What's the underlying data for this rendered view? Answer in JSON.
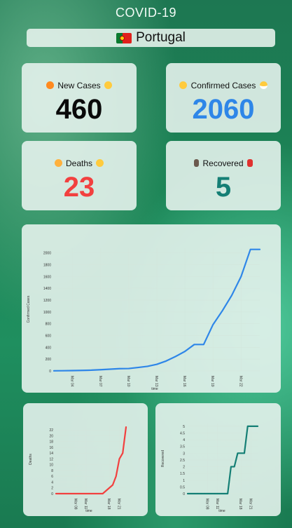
{
  "app": {
    "title": "COVID-19"
  },
  "country": {
    "name": "Portugal",
    "flag_icon": "portugal-flag-icon"
  },
  "stats": [
    {
      "key": "new_cases",
      "label": "New Cases",
      "value": "460",
      "color": "#0a0a0a",
      "icons": [
        "fire-icon",
        "screaming-face-icon"
      ]
    },
    {
      "key": "confirmed",
      "label": "Confirmed Cases",
      "value": "2060",
      "color": "#2e86e8",
      "icons": [
        "sick-face-icon",
        "mask-face-icon"
      ]
    },
    {
      "key": "deaths",
      "label": "Deaths",
      "value": "23",
      "color": "#f2403f",
      "icons": [
        "sad-face-icon",
        "disappointed-face-icon"
      ]
    },
    {
      "key": "recovered",
      "label": "Recovered",
      "value": "5",
      "color": "#157f75",
      "icons": [
        "walking-person-icon",
        "dancing-woman-icon"
      ]
    }
  ],
  "chart_data": [
    {
      "type": "line",
      "xlabel": "time",
      "ylabel": "Confirmed Cases",
      "x": [
        "Mar 02",
        "Mar 03",
        "Mar 04",
        "Mar 05",
        "Mar 06",
        "Mar 07",
        "Mar 08",
        "Mar 09",
        "Mar 10",
        "Mar 11",
        "Mar 12",
        "Mar 13",
        "Mar 14",
        "Mar 15",
        "Mar 16",
        "Mar 17",
        "Mar 18",
        "Mar 19",
        "Mar 20",
        "Mar 21",
        "Mar 22",
        "Mar 23",
        "Mar 24"
      ],
      "xticks": [
        "Mar 04",
        "Mar 07",
        "Mar 10",
        "Mar 13",
        "Mar 16",
        "Mar 19",
        "Mar 22"
      ],
      "yticks": [
        0,
        200,
        400,
        600,
        800,
        1000,
        1200,
        1400,
        1600,
        1800,
        2000
      ],
      "ylim": [
        0,
        2080
      ],
      "color": "#2e86e8",
      "values": [
        2,
        4,
        6,
        9,
        13,
        21,
        30,
        39,
        41,
        59,
        78,
        112,
        169,
        245,
        331,
        448,
        448,
        785,
        1020,
        1280,
        1600,
        2060,
        2060
      ]
    },
    {
      "type": "line",
      "xlabel": "time",
      "ylabel": "Deaths",
      "x": [
        "Mar 02",
        "Mar 03",
        "Mar 04",
        "Mar 05",
        "Mar 06",
        "Mar 07",
        "Mar 08",
        "Mar 09",
        "Mar 10",
        "Mar 11",
        "Mar 12",
        "Mar 13",
        "Mar 14",
        "Mar 15",
        "Mar 16",
        "Mar 17",
        "Mar 18",
        "Mar 19",
        "Mar 20",
        "Mar 21",
        "Mar 22",
        "Mar 23"
      ],
      "xticks": [
        "Mar 08",
        "Mar 11",
        "Mar 18",
        "Mar 21"
      ],
      "yticks": [
        0,
        2,
        4,
        6,
        8,
        10,
        12,
        14,
        16,
        18,
        20,
        22
      ],
      "ylim": [
        0,
        23.5
      ],
      "color": "#f2403f",
      "values": [
        0,
        0,
        0,
        0,
        0,
        0,
        0,
        0,
        0,
        0,
        0,
        0,
        0,
        0,
        0,
        1,
        2,
        3,
        6,
        12,
        14,
        23
      ]
    },
    {
      "type": "line",
      "xlabel": "time",
      "ylabel": "Recovered",
      "x": [
        "Mar 02",
        "Mar 03",
        "Mar 04",
        "Mar 05",
        "Mar 06",
        "Mar 07",
        "Mar 08",
        "Mar 09",
        "Mar 10",
        "Mar 11",
        "Mar 12",
        "Mar 13",
        "Mar 14",
        "Mar 15",
        "Mar 16",
        "Mar 17",
        "Mar 18",
        "Mar 19",
        "Mar 20",
        "Mar 21",
        "Mar 22",
        "Mar 23"
      ],
      "xticks": [
        "Mar 08",
        "Mar 11",
        "Mar 18",
        "Mar 21"
      ],
      "yticks": [
        0,
        0.5,
        1,
        1.5,
        2,
        2.5,
        3,
        3.5,
        4,
        4.5,
        5
      ],
      "ylim": [
        0,
        5.2
      ],
      "color": "#157f75",
      "values": [
        0,
        0,
        0,
        0,
        0,
        0,
        0,
        0,
        0,
        0,
        0,
        0,
        0,
        2,
        2,
        3,
        3,
        3,
        5,
        5,
        5,
        5
      ]
    }
  ]
}
